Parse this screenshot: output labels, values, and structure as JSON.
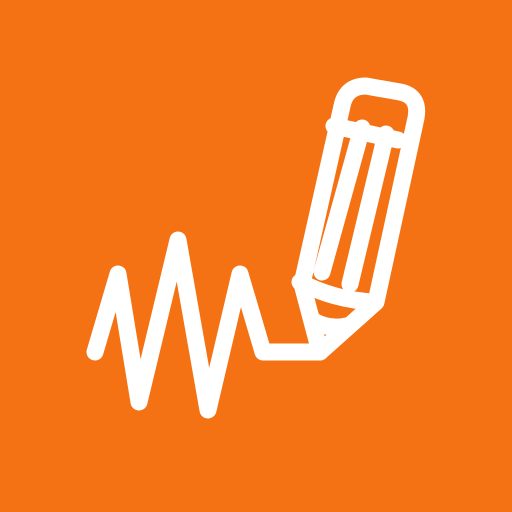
{
  "icon": {
    "name": "pencil-signature-icon",
    "background_color": "#f47213",
    "stroke_color": "#ffffff"
  }
}
